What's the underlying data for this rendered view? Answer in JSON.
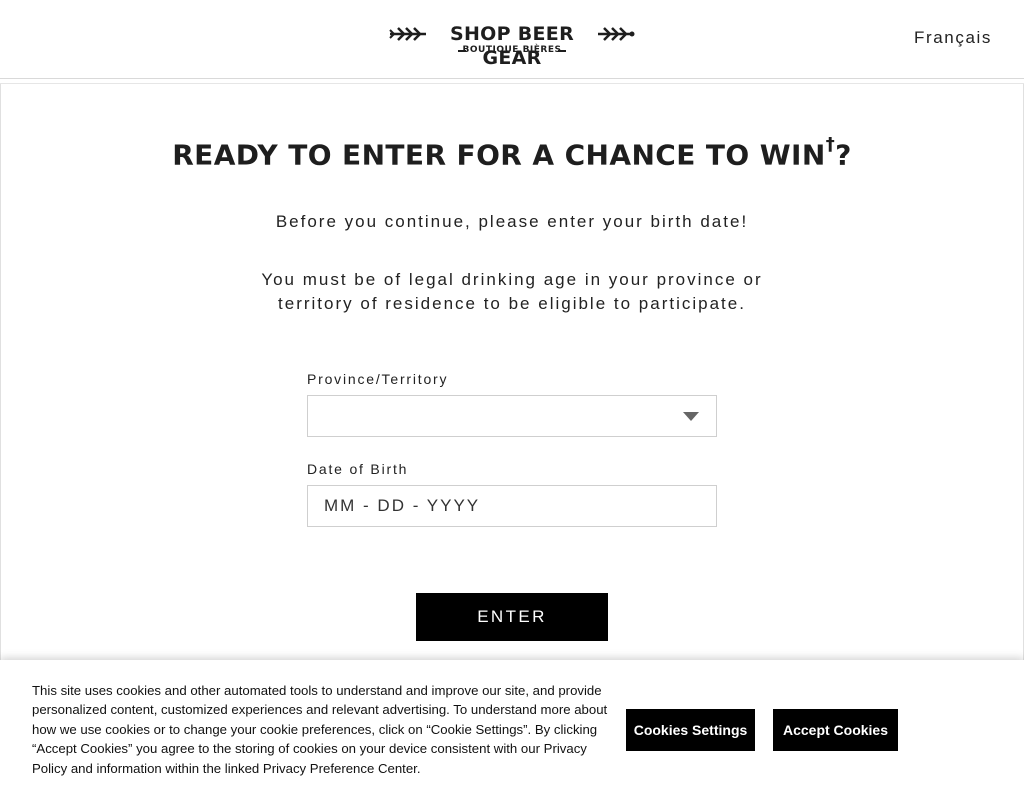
{
  "header": {
    "logo": {
      "title": "SHOP BEER GEAR",
      "subtitle": "BOUTIQUE BIÈRES",
      "left_icon": "arrow-wings-icon",
      "right_icon": "wheat-wings-icon"
    },
    "language_link": "Français"
  },
  "main": {
    "headline": "READY TO ENTER FOR A CHANCE TO WIN",
    "headline_mark": "†",
    "headline_end": "?",
    "intro": "Before you continue, please enter your birth date!",
    "eligibility": "You must be of legal drinking age in your province or territory of residence to be eligible to participate."
  },
  "form": {
    "province_label": "Province/Territory",
    "province_value": "",
    "dob_label": "Date of Birth",
    "dob_placeholder": "MM - DD - YYYY",
    "enter_label": "ENTER"
  },
  "cookie_banner": {
    "text": "This site uses cookies and other automated tools to understand and improve our site, and provide personalized content, customized experiences and relevant advertising. To understand more about how we use cookies or to change your cookie preferences, click on “Cookie Settings”. By clicking “Accept Cookies” you agree to the storing of cookies on your device consistent with our Privacy Policy and information within the linked Privacy Preference Center.",
    "settings_label": "Cookies Settings",
    "accept_label": "Accept Cookies"
  },
  "colors": {
    "button_bg": "#000000",
    "text": "#1e1e1e",
    "border": "#cfcfcf"
  }
}
